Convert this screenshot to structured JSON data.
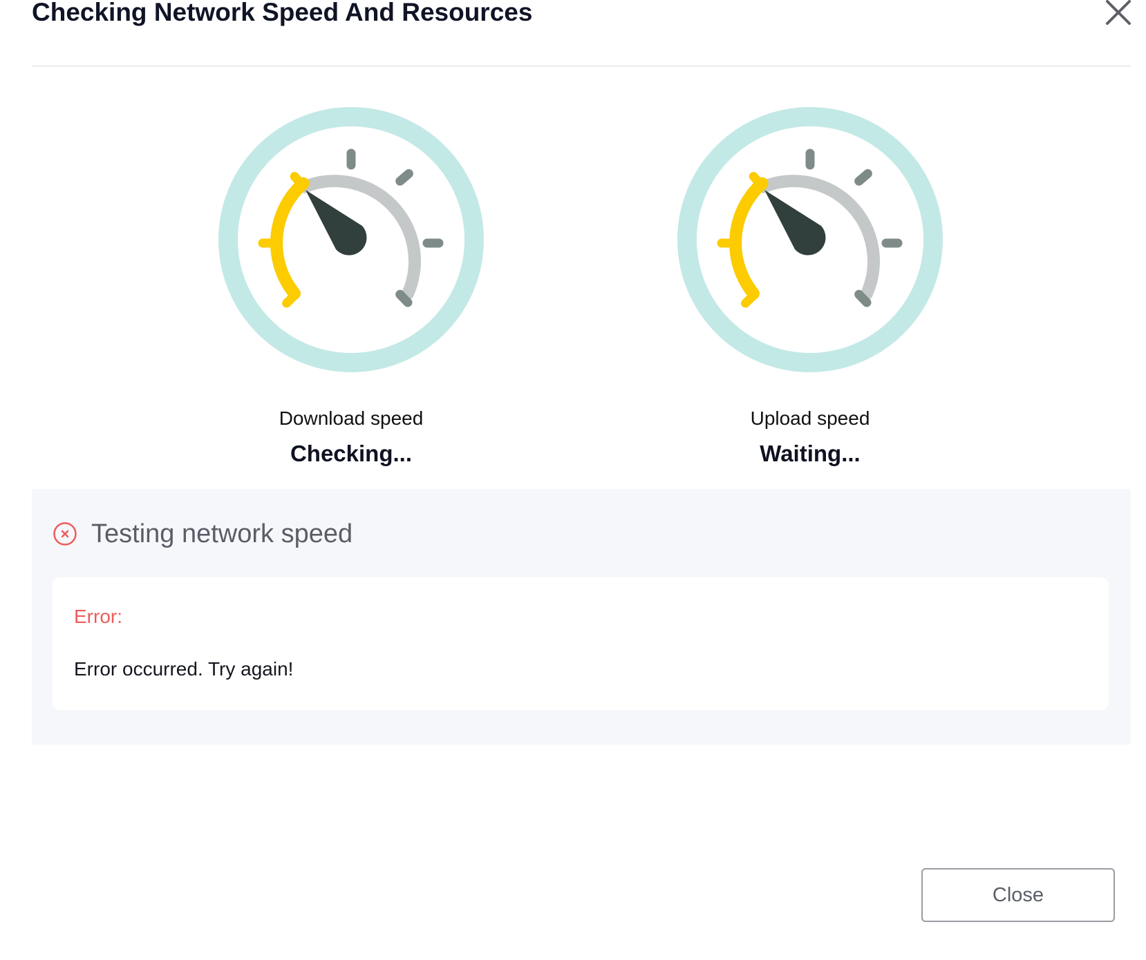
{
  "dialog": {
    "title": "Checking Network Speed And Resources",
    "close_icon": "close-icon"
  },
  "gauges": {
    "download": {
      "label": "Download speed",
      "status": "Checking..."
    },
    "upload": {
      "label": "Upload speed",
      "status": "Waiting..."
    }
  },
  "status_panel": {
    "icon": "error-circle-icon",
    "text": "Testing network speed"
  },
  "error_card": {
    "label": "Error:",
    "message": "Error occurred. Try again!"
  },
  "footer": {
    "close_label": "Close"
  },
  "colors": {
    "gauge_ring": "#c3e9e6",
    "gauge_track": "#c5c8c8",
    "gauge_tick": "#7e8b89",
    "gauge_fill": "#fccb00",
    "gauge_needle": "#313f3d",
    "error": "#ef5b5b",
    "panel_bg": "#f6f7fa"
  }
}
